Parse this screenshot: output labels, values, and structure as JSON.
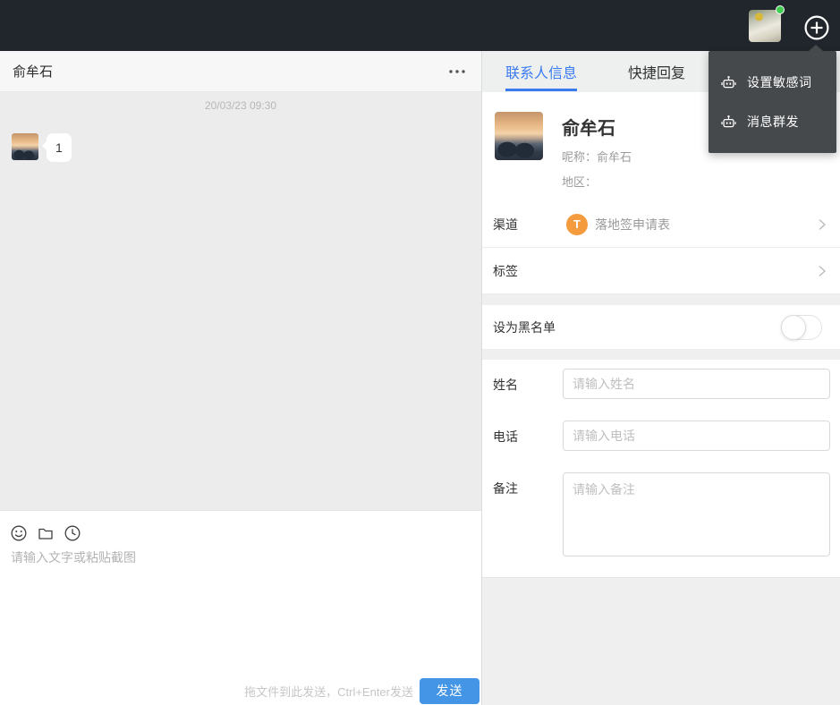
{
  "topbar": {
    "add_tooltip": "+"
  },
  "dropdown_menu": {
    "items": [
      {
        "label": "设置敏感词",
        "icon": "robot-icon"
      },
      {
        "label": "消息群发",
        "icon": "robot-icon"
      }
    ]
  },
  "chat": {
    "title": "俞牟石",
    "timestamp": "20/03/23 09:30",
    "message_text": "1",
    "composer_placeholder": "请输入文字或粘贴截图",
    "send_hint": "拖文件到此发送，Ctrl+Enter发送",
    "send_label": "发送",
    "composer_icons": [
      "smiley-icon",
      "folder-icon",
      "clock-icon"
    ]
  },
  "panel": {
    "tabs": [
      {
        "label": "联系人信息",
        "active": true
      },
      {
        "label": "快捷回复",
        "active": false
      }
    ],
    "contact": {
      "name": "俞牟石",
      "nickname": "呢称：俞牟石",
      "region": "地区："
    },
    "rows": [
      {
        "label": "渠道",
        "value": "落地签申请表",
        "icon_letter": "T"
      },
      {
        "label": "标签",
        "value": ""
      }
    ],
    "blacklist": {
      "label": "设为黑名单",
      "enabled": false
    },
    "form": [
      {
        "label": "姓名",
        "placeholder": "请输入姓名"
      },
      {
        "label": "电话",
        "placeholder": "请输入电话"
      },
      {
        "label": "备注",
        "placeholder": "请输入备注"
      }
    ]
  },
  "colors": {
    "topbar_bg": "#21262d",
    "menu_bg": "#46494c",
    "accent_blue": "#3a7cf0",
    "send_blue": "#4495e5",
    "channel_orange": "#f49b3d",
    "online_green": "#41cd52",
    "chat_bg": "#ececec"
  }
}
